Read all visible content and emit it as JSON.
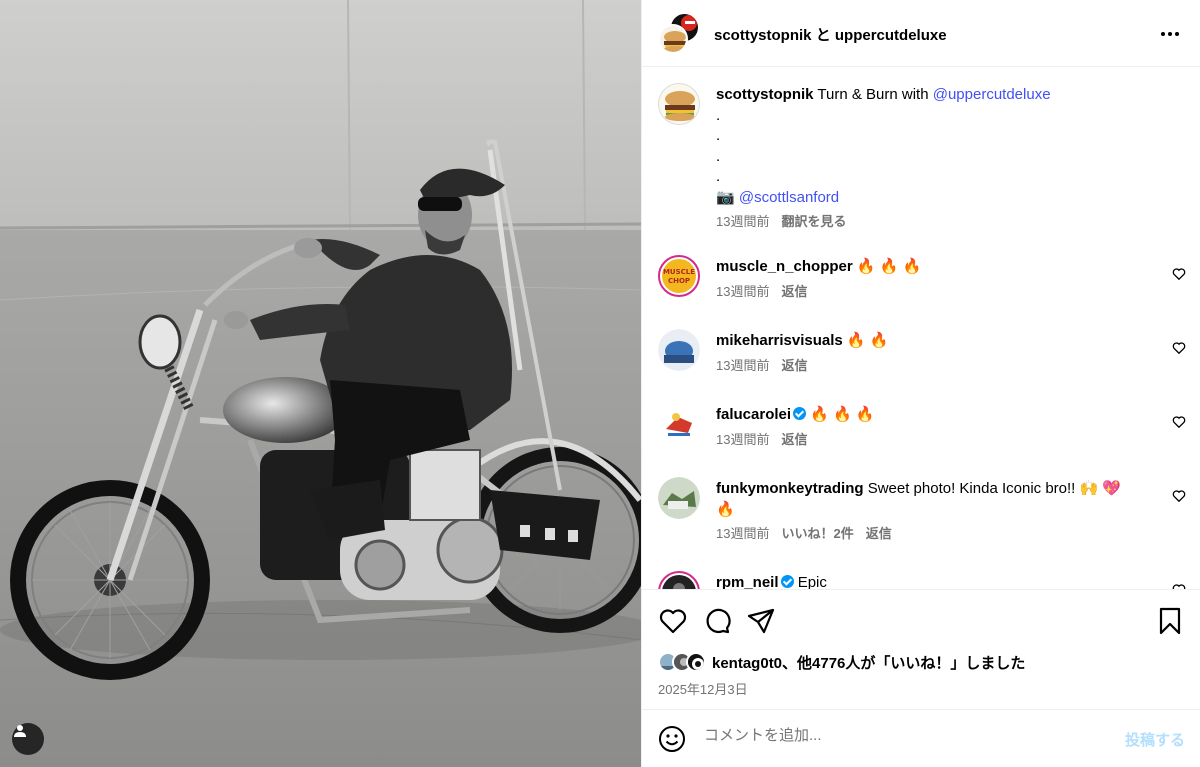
{
  "header": {
    "user1": "scottystopnik",
    "connector": "と",
    "user2": "uppercutdeluxe"
  },
  "caption": {
    "username": "scottystopnik",
    "text": " Turn & Burn with ",
    "mention": "@uppercutdeluxe",
    "dots": [
      ".",
      ".",
      ".",
      "."
    ],
    "camera": "📷",
    "credit": "@scottlsanford",
    "time": "13週間前",
    "translate": "翻訳を見る"
  },
  "comments": [
    {
      "username": "muscle_n_chopper",
      "text": "🔥 🔥 🔥",
      "time": "13週間前",
      "reply": "返信",
      "likes": ""
    },
    {
      "username": "mikeharrisvisuals",
      "text": "🔥 🔥",
      "time": "13週間前",
      "reply": "返信",
      "likes": ""
    },
    {
      "username": "falucarolei",
      "text": "🔥 🔥 🔥",
      "time": "13週間前",
      "reply": "返信",
      "likes": ""
    },
    {
      "username": "funkymonkeytrading",
      "text": "Sweet photo! Kinda Iconic bro!! 🙌 💖 🔥",
      "time": "13週間前",
      "reply": "返信",
      "likes": "いいね！2件"
    },
    {
      "username": "rpm_neil",
      "text": "Epic",
      "time": "",
      "reply": "",
      "likes": ""
    }
  ],
  "likes": {
    "text": "kentag0t0、他4776人が「いいね！」しました"
  },
  "date": "2025年12月3日",
  "add_comment": {
    "placeholder": "コメントを追加...",
    "post_label": "投稿する"
  },
  "icons": {
    "more": "more-horizontal-icon",
    "like": "heart-icon",
    "comment": "comment-icon",
    "share": "share-icon",
    "save": "bookmark-icon",
    "emoji": "emoji-icon",
    "tag": "user-tag-icon"
  },
  "colors": {
    "link": "#4150f7",
    "muted": "#737373",
    "post_disabled": "#b2dffc",
    "verified": "#0095f6",
    "story_ring": "#d42a8c"
  }
}
